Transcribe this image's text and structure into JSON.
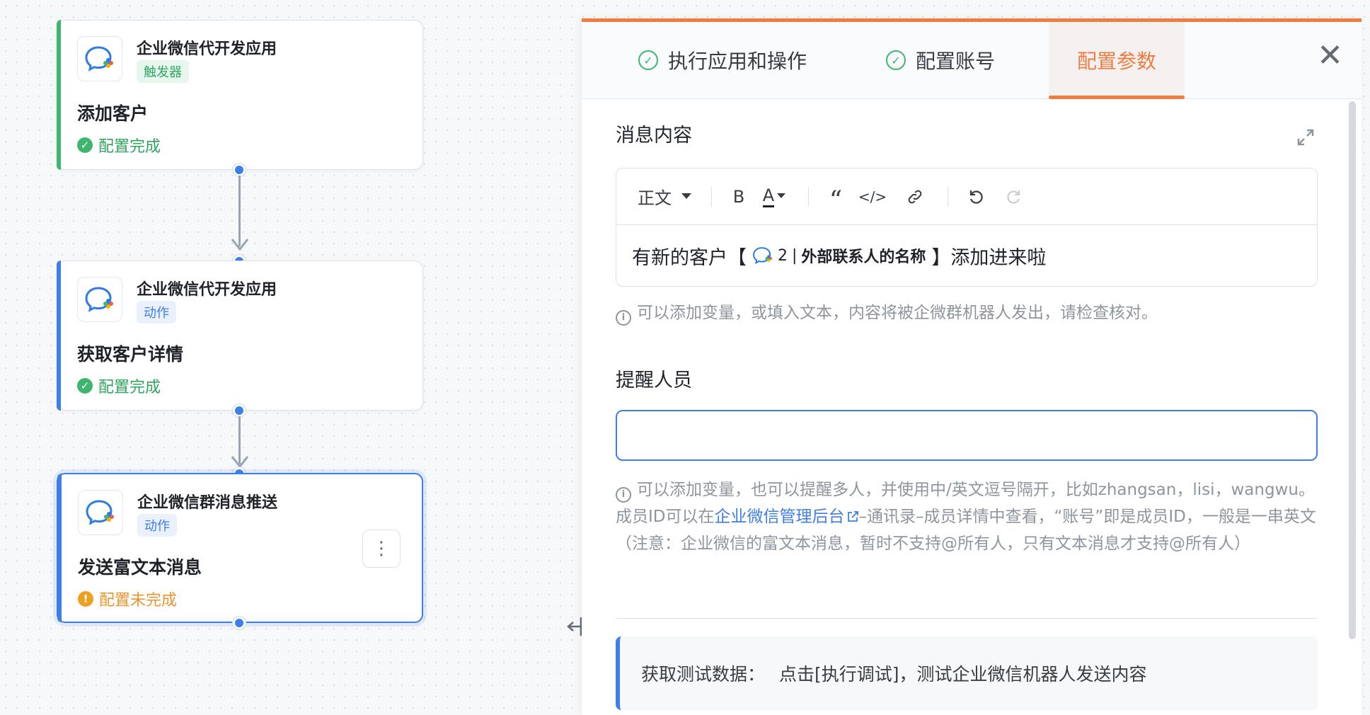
{
  "workflow": {
    "nodes": [
      {
        "app_name": "企业微信代开发应用",
        "tag": "触发器",
        "step_title": "添加客户",
        "status": "配置完成",
        "status_type": "ok",
        "status_icon": "check-circle-icon"
      },
      {
        "app_name": "企业微信代开发应用",
        "tag": "动作",
        "step_title": "获取客户详情",
        "status": "配置完成",
        "status_type": "ok",
        "status_icon": "check-circle-icon"
      },
      {
        "app_name": "企业微信群消息推送",
        "tag": "动作",
        "step_title": "发送富文本消息",
        "status": "配置未完成",
        "status_type": "warn",
        "status_icon": "warning-circle-icon",
        "more_icon": "⋮"
      }
    ]
  },
  "panel": {
    "accent_color": "#ee7d3f",
    "tabs": [
      {
        "label": "执行应用和操作",
        "done": true
      },
      {
        "label": "配置账号",
        "done": true
      },
      {
        "label": "配置参数",
        "active": true
      }
    ],
    "close_icon": "✕",
    "message": {
      "label": "消息内容",
      "toolbar": {
        "format": "正文",
        "bold": "B",
        "font_color": "A",
        "quote": "“",
        "code": "</>",
        "link": "link-icon",
        "undo": "undo-icon",
        "redo": "redo-icon"
      },
      "content_prefix": "有新的客户【",
      "variable_index": "2",
      "variable_sep": "|",
      "variable_name": "外部联系人的名称",
      "content_suffix": "】添加进来啦",
      "hint": "可以添加变量，或填入文本，内容将被企微群机器人发出，请检查核对。"
    },
    "remind": {
      "label": "提醒人员",
      "value": "",
      "hint_part1": "可以添加变量，也可以提醒多人，并使用中/英文逗号隔开，比如zhangsan，lisi，wangwu。成员ID可以在",
      "hint_link": "企业微信管理后台",
      "hint_part2": "–通讯录–成员详情中查看，“账号”即是成员ID，一般是一串英文（注意：企业微信的富文本消息，暂时不支持@所有人，只有文本消息才支持@所有人）"
    },
    "test": {
      "label": "获取测试数据：",
      "text": "点击[执行调试]，测试企业微信机器人发送内容"
    }
  }
}
